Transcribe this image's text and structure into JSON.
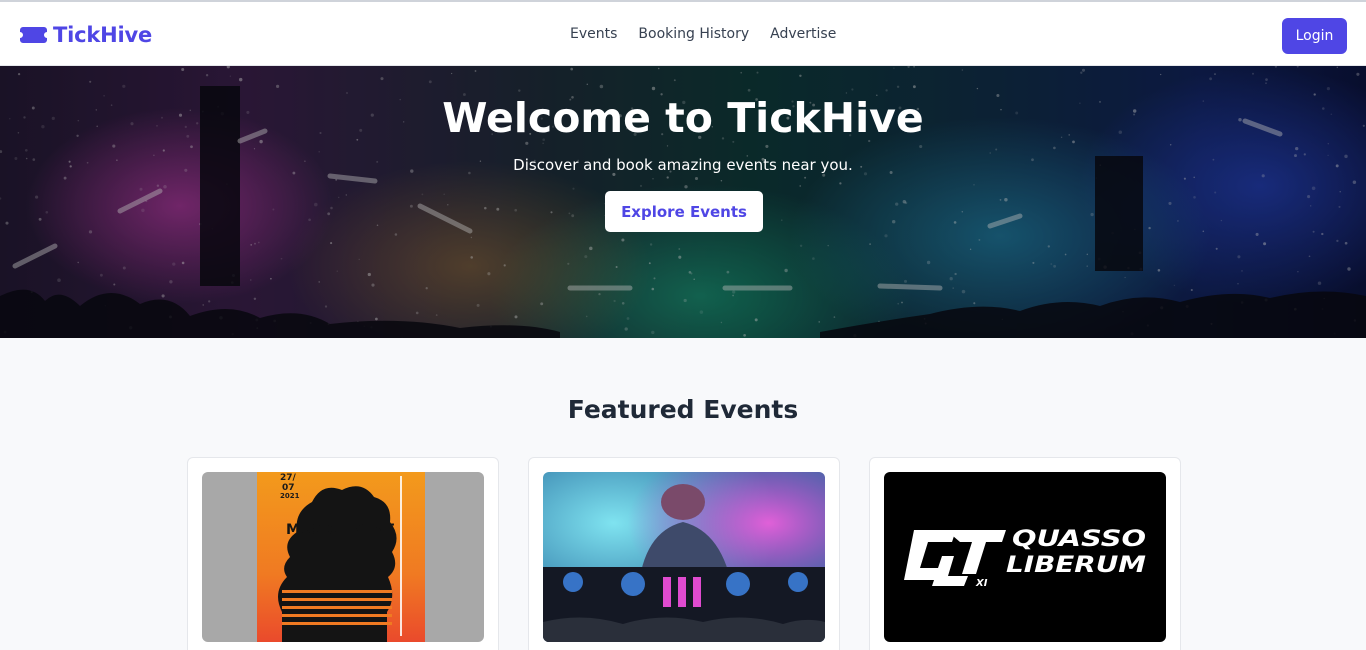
{
  "app": {
    "name": "TickHive",
    "brand_color": "#4f46e5"
  },
  "nav": {
    "links": [
      "Events",
      "Booking History",
      "Advertise"
    ],
    "login_label": "Login"
  },
  "hero": {
    "title": "Welcome to TickHive",
    "subtitle": "Discover and book amazing events near you.",
    "button_label": "Explore Events"
  },
  "featured": {
    "title": "Featured Events",
    "events": [
      {
        "image": "music-event-poster",
        "poster_date": [
          "27/",
          "07",
          "2021"
        ],
        "poster_title": "MUSIC EVENT"
      },
      {
        "image": "dj-performance-photo"
      },
      {
        "image": "quasso-liberum-logo",
        "logo_words": [
          "QUASSO",
          "LIBERUM",
          "XI"
        ]
      }
    ]
  },
  "icons": {
    "brand": "ticket-icon"
  }
}
